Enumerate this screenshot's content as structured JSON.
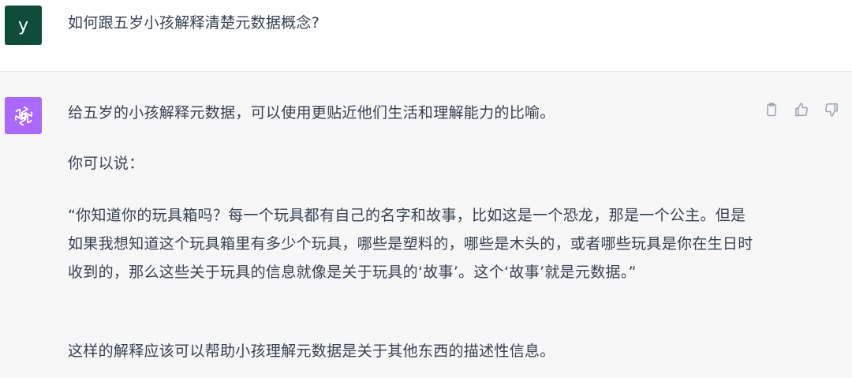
{
  "user": {
    "avatar_letter": "y",
    "question": "如何跟五岁小孩解释清楚元数据概念?"
  },
  "assistant": {
    "avatar_icon": "openai-logo-icon",
    "accent_color": "#ab68ff",
    "paragraphs": [
      "给五岁的小孩解释元数据，可以使用更贴近他们生活和理解能力的比喻。",
      "你可以说：",
      "“你知道你的玩具箱吗？每一个玩具都有自己的名字和故事，比如这是一个恐龙，那是一个公主。但是如果我想知道这个玩具箱里有多少个玩具，哪些是塑料的，哪些是木头的，或者哪些玩具是你在生日时收到的，那么这些关于玩具的信息就像是关于玩具的‘故事’。这个‘故事’就是元数据。”",
      "这样的解释应该可以帮助小孩理解元数据是关于其他东西的描述性信息。"
    ]
  },
  "actions": {
    "icons": [
      "clipboard-icon",
      "thumbs-up-icon",
      "thumbs-down-icon"
    ]
  }
}
